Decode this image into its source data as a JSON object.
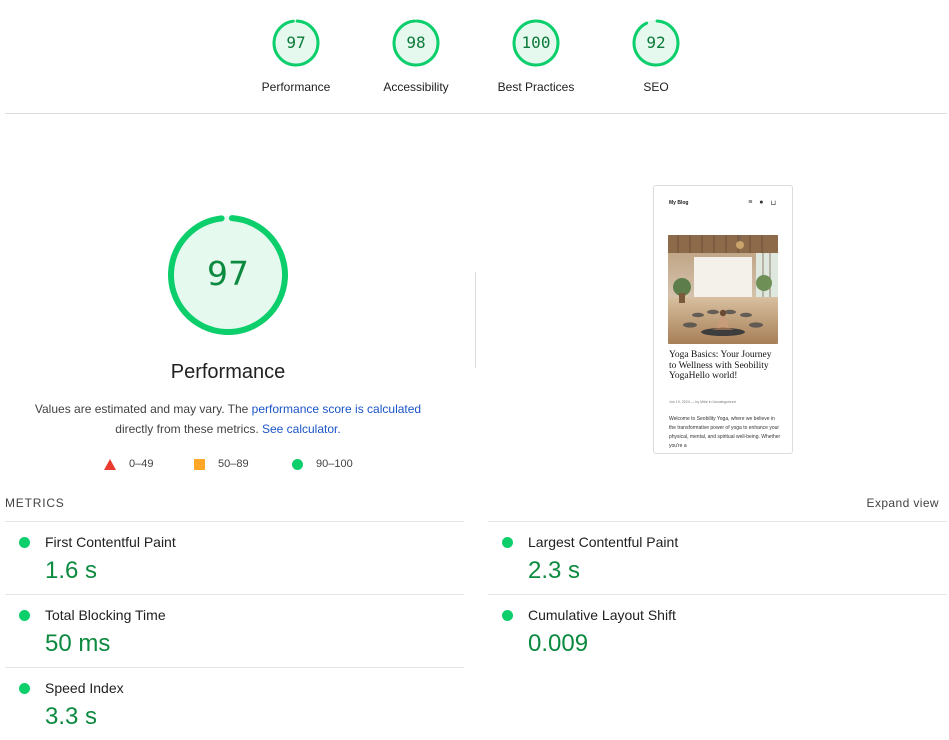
{
  "top_scores": [
    {
      "score": 97,
      "label": "Performance",
      "fraction": 0.97
    },
    {
      "score": 98,
      "label": "Accessibility",
      "fraction": 0.98
    },
    {
      "score": 100,
      "label": "Best Practices",
      "fraction": 1.0
    },
    {
      "score": 92,
      "label": "SEO",
      "fraction": 0.92
    }
  ],
  "performance": {
    "score": 97,
    "fraction": 0.97,
    "title": "Performance",
    "desc_prefix": "Values are estimated and may vary. The ",
    "desc_link1": "performance score is calculated",
    "desc_mid": " directly from these metrics. ",
    "desc_link2": "See calculator.",
    "desc_suffix": ""
  },
  "legend": {
    "fail": "0–49",
    "average": "50–89",
    "pass": "90–100"
  },
  "preview": {
    "site_name": "My Blog",
    "menu_icon": "≡",
    "user_icon": "●",
    "cart_icon": "⊔",
    "title": "Yoga Basics: Your Journey to Wellness with Seobility YogaHello world!",
    "meta": "Jun 19, 2024 — by Mike in Uncategorized",
    "body": "Welcome to Seobility Yoga, where we believe in the transformative power of yoga to enhance your physical, mental, and spiritual well-being. Whether you're a"
  },
  "metrics": {
    "section_label": "METRICS",
    "expand_label": "Expand view",
    "items": [
      {
        "name": "First Contentful Paint",
        "value": "1.6 s"
      },
      {
        "name": "Largest Contentful Paint",
        "value": "2.3 s"
      },
      {
        "name": "Total Blocking Time",
        "value": "50 ms"
      },
      {
        "name": "Cumulative Layout Shift",
        "value": "0.009"
      },
      {
        "name": "Speed Index",
        "value": "3.3 s"
      }
    ]
  },
  "colors": {
    "pass": "#0cce6b",
    "pass_text": "#0c8a3f",
    "pass_fill": "#e6f9ef",
    "average": "#ffa726",
    "fail": "#eb3b2f",
    "link": "#1a54c8"
  }
}
